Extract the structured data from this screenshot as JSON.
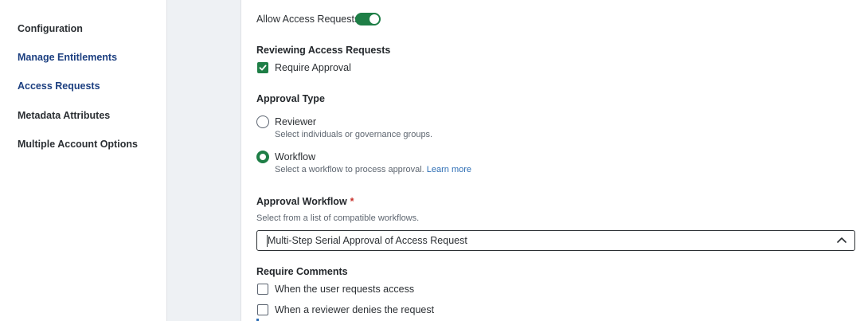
{
  "sidebar": {
    "items": [
      {
        "label": "Configuration"
      },
      {
        "label": "Manage Entitlements"
      },
      {
        "label": "Access Requests"
      },
      {
        "label": "Metadata Attributes"
      },
      {
        "label": "Multiple Account Options"
      }
    ]
  },
  "form": {
    "allow_access_requests": {
      "label": "Allow Access Requests",
      "enabled": true
    },
    "reviewing": {
      "heading": "Reviewing Access Requests",
      "require_approval_label": "Require Approval",
      "require_approval_checked": true
    },
    "approval_type": {
      "heading": "Approval Type",
      "options": [
        {
          "label": "Reviewer",
          "description": "Select individuals or governance groups.",
          "selected": false
        },
        {
          "label": "Workflow",
          "description": "Select a workflow to process approval.",
          "link": "Learn more",
          "selected": true
        }
      ]
    },
    "approval_workflow": {
      "heading": "Approval Workflow",
      "required_mark": "*",
      "hint": "Select from a list of compatible workflows.",
      "selected_value": "Multi-Step Serial Approval of Access Request"
    },
    "require_comments": {
      "heading": "Require Comments",
      "options": [
        {
          "label": "When the user requests access",
          "checked": false
        },
        {
          "label": "When a reviewer denies the request",
          "checked": false
        }
      ]
    }
  },
  "colors": {
    "accent_green": "#1e7e46",
    "nav_blue": "#1c3f80",
    "link_blue": "#2f6fb5",
    "required_red": "#c8312b"
  },
  "icons": {
    "toggle": "toggle-on-icon",
    "check": "checkmark-icon",
    "dropdown": "chevron-up-icon"
  }
}
